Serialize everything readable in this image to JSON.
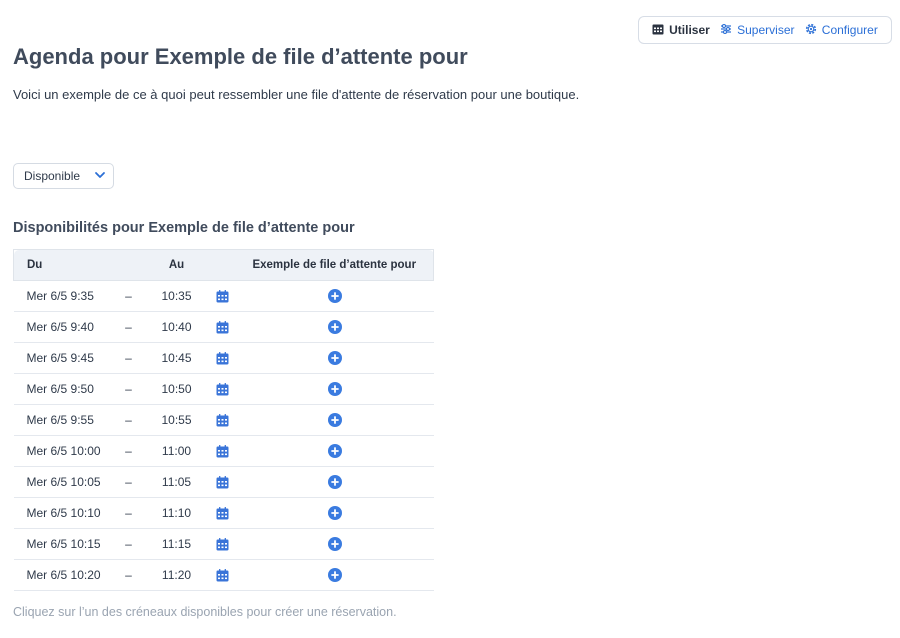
{
  "mode_switch": {
    "use_label": "Utiliser",
    "supervise_label": "Superviser",
    "configure_label": "Configurer"
  },
  "page": {
    "title": "Agenda pour Exemple de file d’attente pour",
    "description": "Voici un exemple de ce à quoi peut ressembler une file d'attente de réservation pour une boutique."
  },
  "filter": {
    "status_value": "Disponible"
  },
  "availability": {
    "section_title": "Disponibilités pour Exemple de file d’attente pour",
    "headers": {
      "from": "Du",
      "to": "Au",
      "queue": "Exemple de file d’attente pour"
    },
    "dash": "–",
    "rows": [
      {
        "from": "Mer 6/5 9:35",
        "to": "10:35"
      },
      {
        "from": "Mer 6/5 9:40",
        "to": "10:40"
      },
      {
        "from": "Mer 6/5 9:45",
        "to": "10:45"
      },
      {
        "from": "Mer 6/5 9:50",
        "to": "10:50"
      },
      {
        "from": "Mer 6/5 9:55",
        "to": "10:55"
      },
      {
        "from": "Mer 6/5 10:00",
        "to": "11:00"
      },
      {
        "from": "Mer 6/5 10:05",
        "to": "11:05"
      },
      {
        "from": "Mer 6/5 10:10",
        "to": "11:10"
      },
      {
        "from": "Mer 6/5 10:15",
        "to": "11:15"
      },
      {
        "from": "Mer 6/5 10:20",
        "to": "11:20"
      }
    ],
    "footer_hint": "Cliquez sur l’un des créneaux disponibles pour créer une réservation."
  },
  "icons": {
    "use": "calendar-grid-icon",
    "supervise": "sliders-icon",
    "configure": "gear-icon",
    "dropdown": "chevron-down-icon",
    "row_calendar": "calendar-icon",
    "row_add": "plus-circle-icon"
  },
  "colors": {
    "accent": "#2b6fd6",
    "calendar_icon": "#3a74d8",
    "add_icon": "#3a7be0",
    "header_bg": "#eef2f7",
    "muted_text": "#9aa4b1"
  }
}
